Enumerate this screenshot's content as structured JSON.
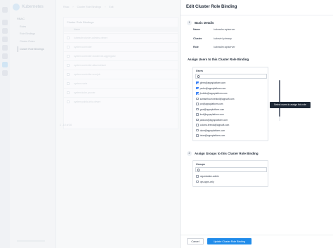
{
  "app": {
    "brand_name": "Kubernetes"
  },
  "sidebar": {
    "group_label": "RBAC",
    "items": [
      {
        "label": "Roles"
      },
      {
        "label": "Role Bindings"
      },
      {
        "label": "Cluster Roles"
      },
      {
        "label": "Cluster Role Bindings"
      }
    ]
  },
  "background": {
    "breadcrumbs": [
      "Rbac",
      "Cluster Role Bindings",
      "Edit"
    ],
    "card_title": "Cluster Role Bindings",
    "column_name": "Name",
    "rows": [
      "kubeadm:cluster-admins-viewer",
      "system:controller",
      "system:controller:clusterrole-aggregator",
      "system:controller:attachdetach",
      "system:controller:cronjob",
      "system:node",
      "system:kube-proxier",
      "system:public-info-viewer"
    ],
    "pager": "1 - 10 of 30"
  },
  "drawer": {
    "title": "Edit Cluster Role Binding",
    "basic_details": {
      "step": "1",
      "title": "Basic Details",
      "fields": [
        {
          "label": "Name",
          "value": "kubeadm:apiserver"
        },
        {
          "label": "Cluster",
          "value": "kubevirt-primary"
        },
        {
          "label": "Role",
          "value": "kubeadm:apiserver"
        }
      ]
    },
    "assign_users": {
      "title": "Assign Users to this Cluster Role Binding",
      "list_label": "Users",
      "search_placeholder": "",
      "options": [
        {
          "label": "glenn@appsplatform.com",
          "checked": true
        },
        {
          "label": "pedro@appsplatform.com",
          "checked": true
        },
        {
          "label": "jhubble@appsplatform.com",
          "checked": true
        },
        {
          "label": "samantha.moreland@appsoft.com",
          "checked": false
        },
        {
          "label": "jon@appsplatform.com",
          "checked": false
        },
        {
          "label": "goal@appsplatform.com",
          "checked": false
        },
        {
          "label": "fred@appsplatform.com",
          "checked": false
        },
        {
          "label": "jackson@appsplatform.com",
          "checked": false
        },
        {
          "label": "coloma.brenda@appsoft.com",
          "checked": false
        },
        {
          "label": "dave@appsplatform.com",
          "checked": false
        },
        {
          "label": "brian@appsplatform.com",
          "checked": false
        }
      ]
    },
    "tooltip": "Select users to assign this role",
    "assign_groups": {
      "step": "2",
      "title": "Assign Groups to this Cluster Role Binding",
      "list_label": "Groups",
      "search_placeholder": "",
      "options": [
        {
          "label": "organization-admin",
          "checked": false
        },
        {
          "label": "ops-apps-only",
          "checked": false
        }
      ]
    },
    "footer": {
      "cancel_label": "Cancel",
      "submit_label": "Update Cluster Role Binding"
    }
  }
}
